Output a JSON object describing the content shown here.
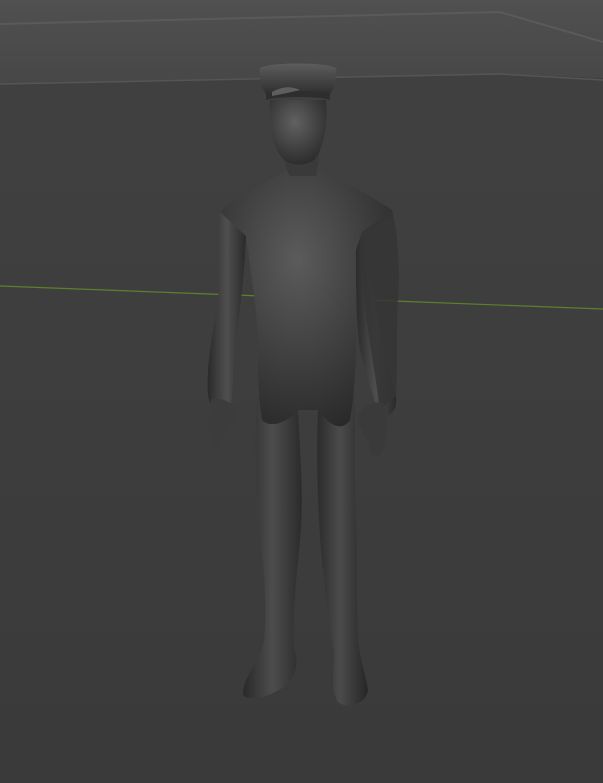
{
  "viewport": {
    "colors": {
      "background": "#3d3d3d",
      "horizon_strip": "#4a4a4a",
      "floor_plane_edge": "#5a5a5a",
      "x_axis_line": "#5f7f2c",
      "model_base": "#3b3b3b",
      "model_light": "#5a5a5a",
      "model_dark": "#232323"
    },
    "scene_items": [
      "floor-plane",
      "x-axis-line",
      "character-model"
    ],
    "character": {
      "description_icon": "human-figure-icon",
      "hat_icon": "peaked-cap-icon"
    }
  }
}
